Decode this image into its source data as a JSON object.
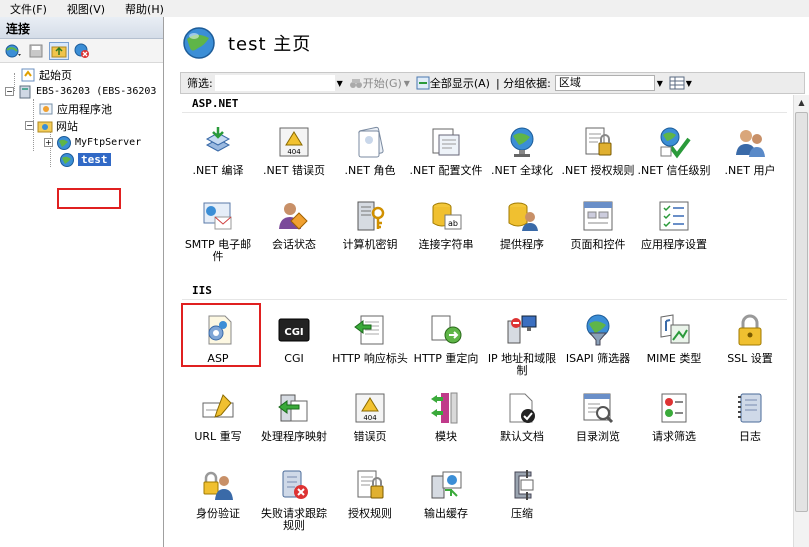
{
  "menu": [
    "文件(F)",
    "视图(V)",
    "帮助(H)"
  ],
  "left": {
    "header": "连接",
    "tree": {
      "start_page": "起始页",
      "server": "EBS-36203 (EBS-36203",
      "app_pools": "应用程序池",
      "sites": "网站",
      "site1": "MyFtpServer",
      "site2": "test"
    }
  },
  "title": "test 主页",
  "filterbar": {
    "filter_label": "筛选:",
    "go": "开始(G)",
    "show_all": "全部显示(A)",
    "group_by": "分组依据:",
    "group_value": "区域"
  },
  "sections": {
    "aspnet": "ASP.NET",
    "iis": "IIS"
  },
  "features": {
    "aspnet_row1": [
      ".NET 编译",
      ".NET 错误页",
      ".NET 角色",
      ".NET 配置文件",
      ".NET 全球化",
      ".NET 授权规则",
      ".NET 信任级别",
      ".NET 用户"
    ],
    "aspnet_row2": [
      "SMTP 电子邮件",
      "会话状态",
      "计算机密钥",
      "连接字符串",
      "提供程序",
      "页面和控件",
      "应用程序设置"
    ],
    "iis_row1": [
      "ASP",
      "CGI",
      "HTTP 响应标头",
      "HTTP 重定向",
      "IP 地址和域限制",
      "ISAPI 筛选器",
      "MIME 类型",
      "SSL 设置"
    ],
    "iis_row2": [
      "URL 重写",
      "处理程序映射",
      "错误页",
      "模块",
      "默认文档",
      "目录浏览",
      "请求筛选",
      "日志"
    ],
    "iis_row3": [
      "身份验证",
      "失败请求跟踪规则",
      "授权规则",
      "输出缓存",
      "压缩"
    ]
  }
}
